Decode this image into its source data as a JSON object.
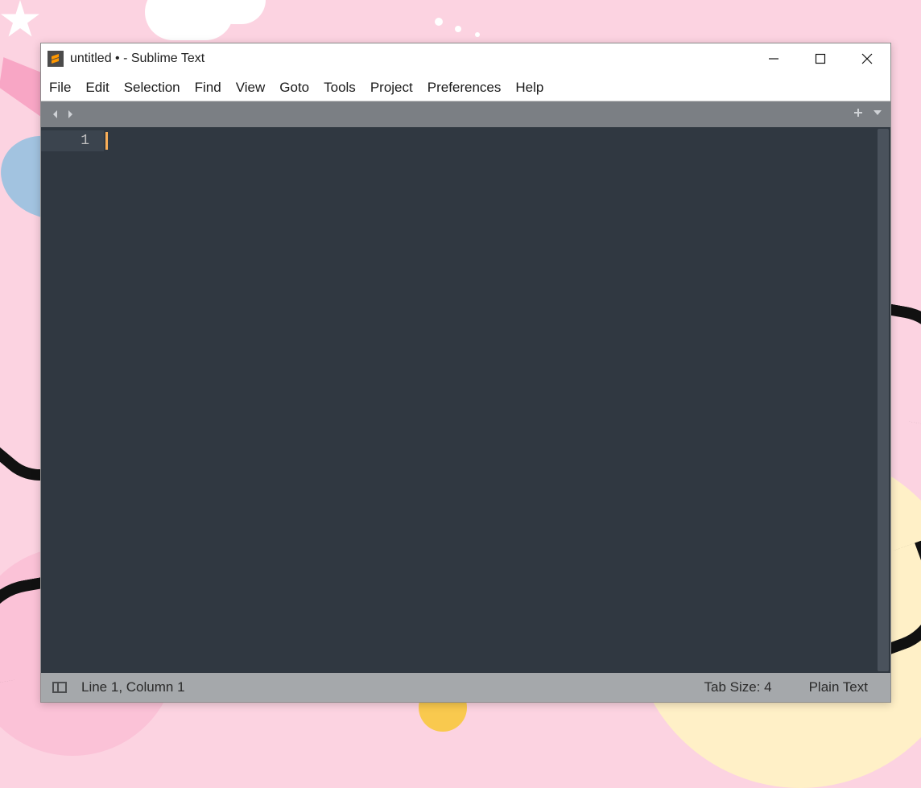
{
  "window": {
    "title": "untitled • - Sublime Text"
  },
  "menu": {
    "items": [
      "File",
      "Edit",
      "Selection",
      "Find",
      "View",
      "Goto",
      "Tools",
      "Project",
      "Preferences",
      "Help"
    ]
  },
  "editor": {
    "line_number": "1",
    "content": ""
  },
  "status": {
    "position": "Line 1, Column 1",
    "tab_size": "Tab Size: 4",
    "syntax": "Plain Text"
  }
}
